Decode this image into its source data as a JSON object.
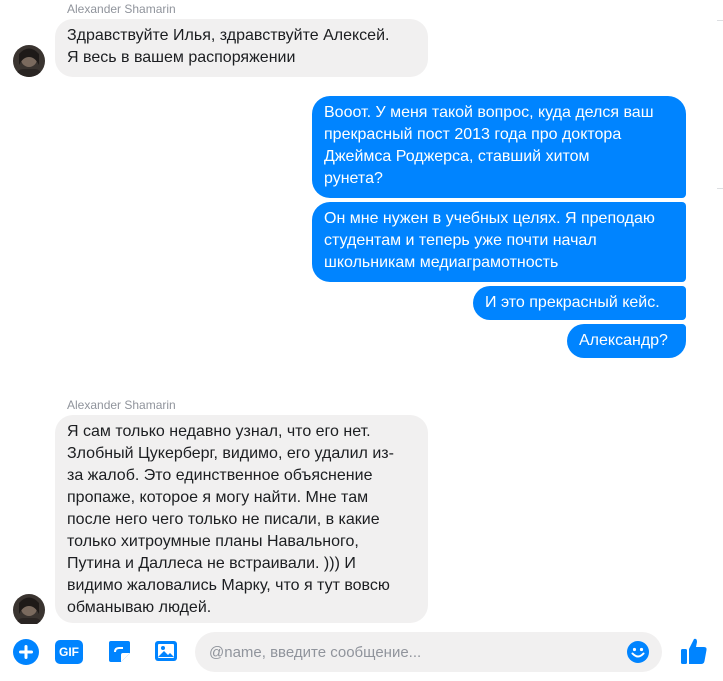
{
  "thread": {
    "sender_name_1": "Alexander Shamarin",
    "sender_name_2": "Alexander Shamarin",
    "messages": {
      "m1": "Здравствуйте Илья, здравствуйте Алексей.\nЯ весь в вашем распоряжении",
      "m2": "Вооот. У меня такой вопрос, куда делся ваш\nпрекрасный пост 2013 года про доктора\nДжеймса Роджерса, ставший хитом\nрунета?",
      "m3": "Он мне нужен в учебных целях. Я преподаю\nстудентам и теперь уже почти начал\nшкольникам медиаграмотность",
      "m4": "И это прекрасный кейс.",
      "m5": "Александр?",
      "m6": "Я сам только недавно узнал, что его нет.\nЗлобный Цукерберг, видимо, его удалил из-\nза жалоб. Это единственное объяснение\nпропаже, которое я могу найти. Мне там\nпосле него чего только не писали, в какие\nтолько хитроумные планы Навального,\nПутина и Даллеса не встраивали. ))) И\nвидимо жаловались Марку, что я тут вовсю\nобманываю людей."
    }
  },
  "composer": {
    "placeholder": "@name, введите сообщение...",
    "gif_label": "GIF"
  },
  "colors": {
    "accent": "#0084ff",
    "incoming_bubble": "#f1f0f0"
  }
}
